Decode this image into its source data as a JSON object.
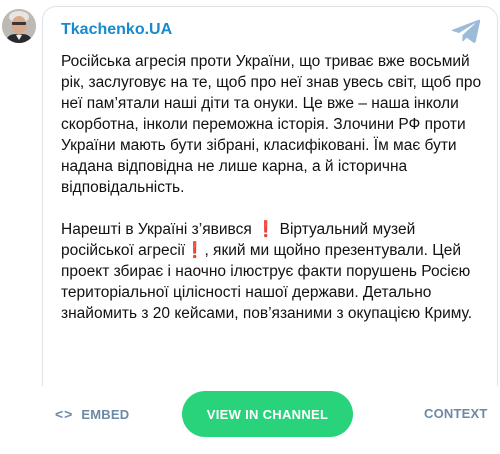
{
  "channel": {
    "name": "Tkachenko.UA",
    "avatar_icon": "person-avatar",
    "platform_icon": "telegram-icon",
    "accent_color": "#168acd"
  },
  "message": {
    "paragraph1": "Російська агресія проти України, що триває вже восьмий рік, заслуговує на те, щоб про неї знав увесь світ, щоб про неї пам’ятали наші діти та онуки. Це вже – наша інколи скорботна, інколи переможна історія. Злочини РФ проти України мають бути зібрані, класифіковані. Їм має бути надана відповідна не лише карна, а й історична відповідальність.",
    "p2_part1": "Нарешті в Україні з’явився ",
    "p2_emoji1": "❗",
    "p2_part2": " Віртуальний музей російської агресії",
    "p2_emoji2": "❗",
    "p2_part3": ", який ми щойно презентували. Цей проект збирає і наочно ілюструє факти порушень Росією територіальної цілісності нашої держави. Детально знайомить з 20 кейсами, пов’язаними з окупацією Криму."
  },
  "footer": {
    "embed_icon": "<>",
    "embed_label": "EMBED",
    "view_label": "VIEW IN CHANNEL",
    "context_label": "CONTEXT",
    "button_color": "#29d37b"
  }
}
